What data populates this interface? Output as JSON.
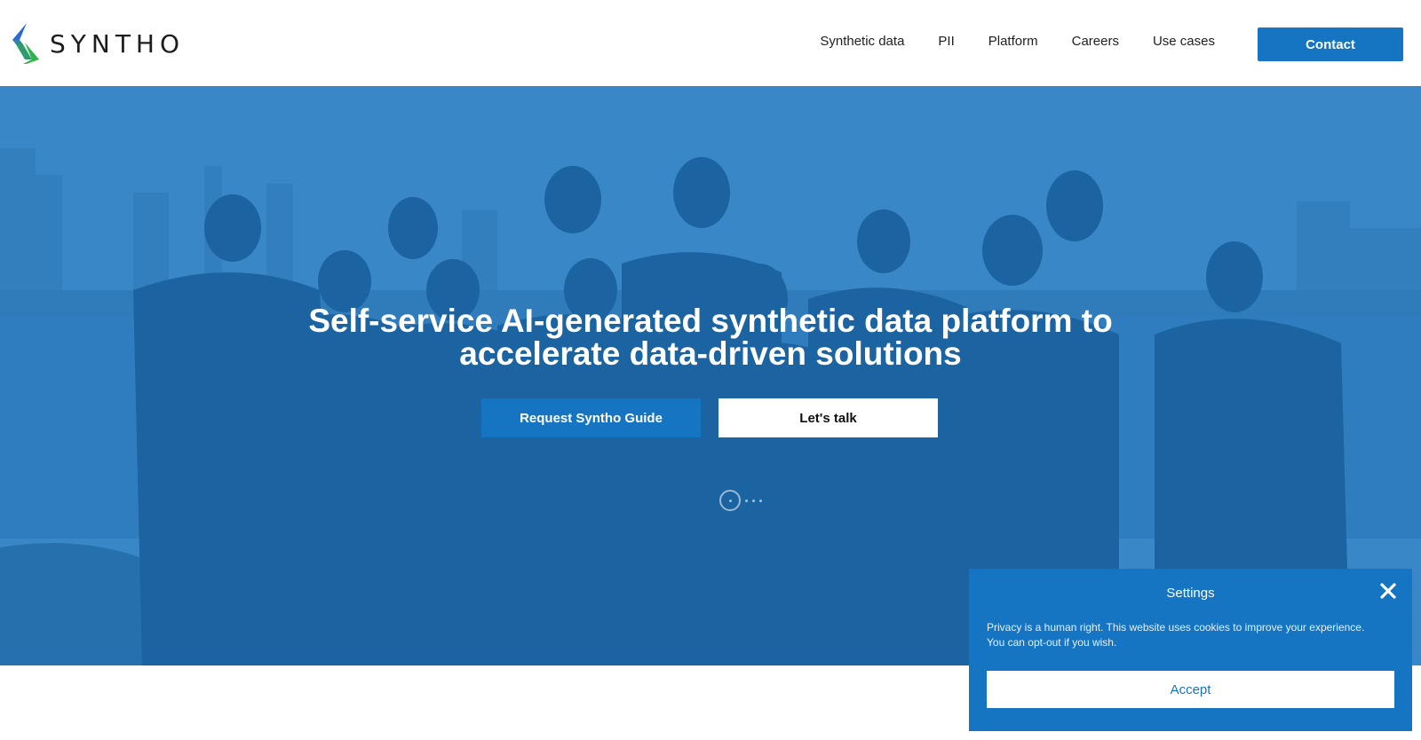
{
  "brand": {
    "name": "SYNTHO",
    "accent_color": "#1575c2"
  },
  "nav": {
    "items": [
      {
        "label": "Synthetic data"
      },
      {
        "label": "PII"
      },
      {
        "label": "Platform"
      },
      {
        "label": "Careers"
      },
      {
        "label": "Use cases"
      }
    ],
    "contact_label": "Contact"
  },
  "hero": {
    "title_line1": "Self-service AI-generated synthetic data platform to",
    "title_line2": "accelerate data-driven solutions",
    "primary_button": "Request Syntho Guide",
    "secondary_button": "Let's talk"
  },
  "cookie": {
    "title": "Settings",
    "text_line1": "Privacy is a human right. This website uses cookies to improve your experience.",
    "text_line2": "You can opt-out if you wish.",
    "accept_label": "Accept"
  }
}
